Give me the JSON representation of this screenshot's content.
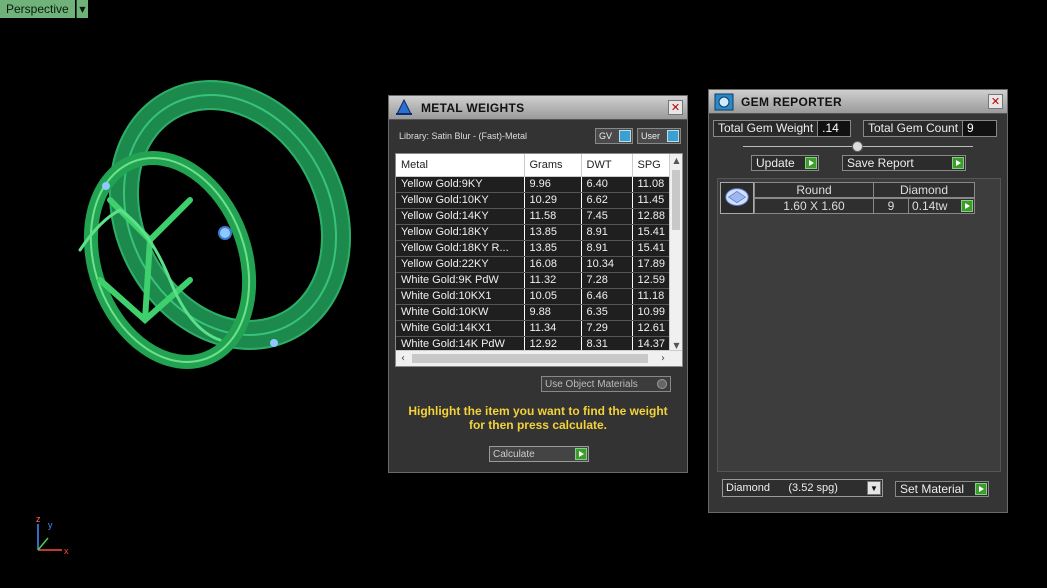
{
  "viewport": {
    "label": "Perspective"
  },
  "metal_weights": {
    "title": "METAL WEIGHTS",
    "library": "Library: Satin Blur - (Fast)-Metal",
    "toggle_gv": "GV",
    "toggle_user": "User",
    "columns": [
      "Metal",
      "Grams",
      "DWT",
      "SPG"
    ],
    "rows": [
      [
        "Yellow Gold:9KY",
        "9.96",
        "6.40",
        "11.08"
      ],
      [
        "Yellow Gold:10KY",
        "10.29",
        "6.62",
        "11.45"
      ],
      [
        "Yellow Gold:14KY",
        "11.58",
        "7.45",
        "12.88"
      ],
      [
        "Yellow Gold:18KY",
        "13.85",
        "8.91",
        "15.41"
      ],
      [
        "Yellow Gold:18KY R...",
        "13.85",
        "8.91",
        "15.41"
      ],
      [
        "Yellow Gold:22KY",
        "16.08",
        "10.34",
        "17.89"
      ],
      [
        "White Gold:9K PdW",
        "11.32",
        "7.28",
        "12.59"
      ],
      [
        "White Gold:10KX1",
        "10.05",
        "6.46",
        "11.18"
      ],
      [
        "White Gold:10KW",
        "9.88",
        "6.35",
        "10.99"
      ],
      [
        "White Gold:14KX1",
        "11.34",
        "7.29",
        "12.61"
      ],
      [
        "White Gold:14K PdW",
        "12.92",
        "8.31",
        "14.37"
      ]
    ],
    "use_object_materials": "Use Object Materials",
    "hint_line1": "Highlight the item you want to find the weight",
    "hint_line2": "for then press calculate.",
    "calculate": "Calculate"
  },
  "gem_reporter": {
    "title": "GEM REPORTER",
    "total_weight_label": "Total Gem Weight",
    "total_weight_value": ".14",
    "total_count_label": "Total Gem Count",
    "total_count_value": "9",
    "update": "Update",
    "save_report": "Save Report",
    "gem": {
      "shape": "Round",
      "material": "Diamond",
      "size": "1.60 X 1.60",
      "count": "9",
      "weight": "0.14tw"
    },
    "material_select": "Diamond      (3.52 spg)",
    "set_material": "Set Material"
  },
  "colors": {
    "ring_green": "#2fbf6a",
    "highlight_yellow": "#f3d23a",
    "go_green": "#3c9c2c"
  }
}
